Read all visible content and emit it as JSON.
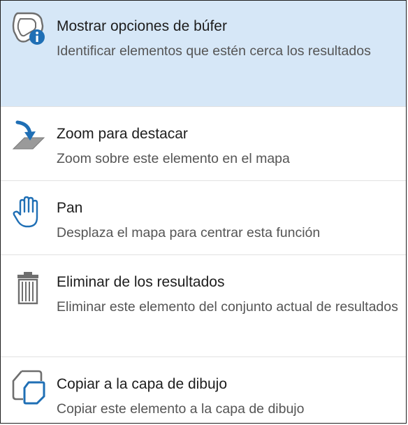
{
  "colors": {
    "highlight_background": "#d6e7f7",
    "icon_blue": "#1f6fb5",
    "icon_gray": "#6e6e6e",
    "title_text": "#1d1d1d",
    "description_text": "#555555",
    "border": "#1f1f1f"
  },
  "menu": {
    "items": [
      {
        "icon": "buffer-info-icon",
        "title": "Mostrar opciones de búfer",
        "description": "Identificar elementos que estén cerca los resultados",
        "highlighted": true
      },
      {
        "icon": "zoom-to-feature-icon",
        "title": "Zoom para destacar",
        "description": "Zoom sobre este elemento en el mapa",
        "highlighted": false
      },
      {
        "icon": "pan-hand-icon",
        "title": "Pan",
        "description": "Desplaza el mapa para centrar esta función",
        "highlighted": false
      },
      {
        "icon": "trash-icon",
        "title": "Eliminar de los resultados",
        "description": "Eliminar este elemento del conjunto actual de resultados",
        "highlighted": false
      },
      {
        "icon": "copy-to-drawing-layer-icon",
        "title": "Copiar a la capa de dibujo",
        "description": "Copiar este elemento a la capa de dibujo",
        "highlighted": false
      }
    ]
  }
}
